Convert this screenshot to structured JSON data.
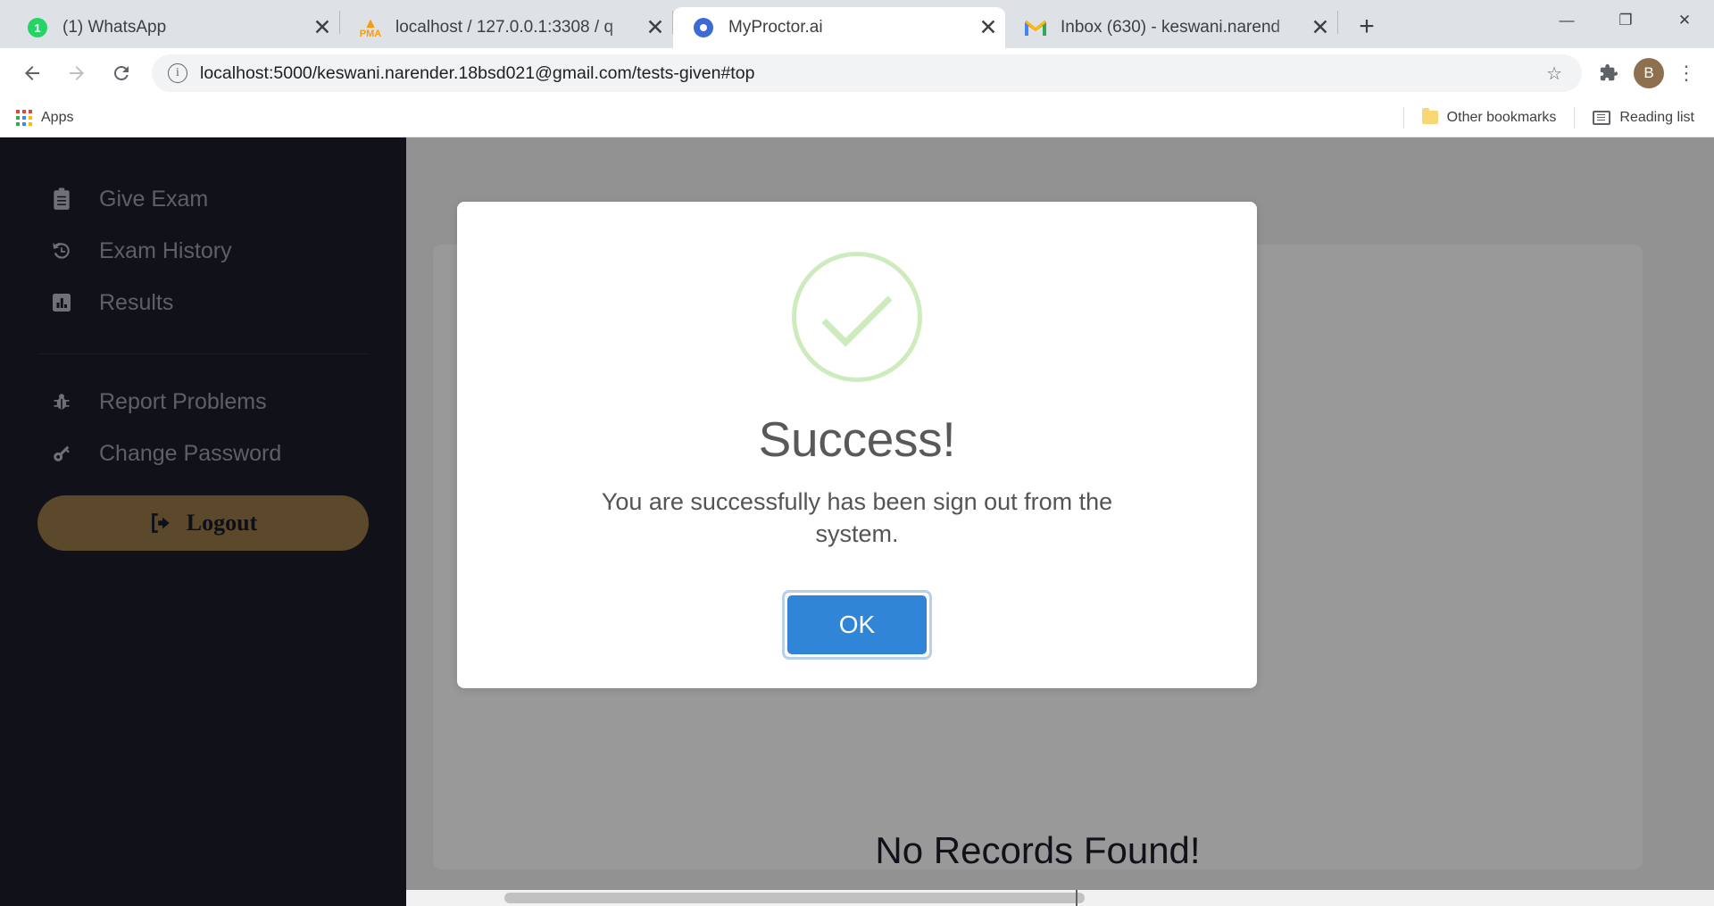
{
  "browser": {
    "tabs": [
      {
        "title": "(1) WhatsApp",
        "favicon": "whatsapp-icon",
        "badge": "1",
        "active": false
      },
      {
        "title": "localhost / 127.0.0.1:3308 / q",
        "favicon": "phpmyadmin-icon",
        "active": false
      },
      {
        "title": "MyProctor.ai",
        "favicon": "myproctor-icon",
        "active": true
      },
      {
        "title": "Inbox (630) - keswani.narend",
        "favicon": "gmail-icon",
        "active": false
      }
    ],
    "new_tab_label": "+",
    "close_label": "✕",
    "window_controls": {
      "minimize": "—",
      "maximize": "❐",
      "close": "✕"
    },
    "toolbar": {
      "back": "←",
      "forward": "→",
      "reload": "↻",
      "info_icon": "i",
      "url": "localhost:5000/keswani.narender.18bsd021@gmail.com/tests-given#top",
      "star": "☆",
      "extensions": "🧩",
      "profile_initial": "B",
      "menu": "⋮"
    },
    "bookmarks": {
      "apps_label": "Apps",
      "other_bookmarks_label": "Other bookmarks",
      "reading_list_label": "Reading list"
    }
  },
  "sidebar": {
    "items": [
      {
        "label": "Give Exam",
        "icon": "clipboard-icon",
        "glyph": "📋"
      },
      {
        "label": "Exam History",
        "icon": "history-icon",
        "glyph": "↺"
      },
      {
        "label": "Results",
        "icon": "chart-bar-icon",
        "glyph": "📊"
      }
    ],
    "items_secondary": [
      {
        "label": "Report Problems",
        "icon": "bug-icon",
        "glyph": "🐞"
      },
      {
        "label": "Change Password",
        "icon": "key-icon",
        "glyph": "🔑"
      }
    ],
    "logout": {
      "label": "Logout",
      "icon": "sign-out-icon",
      "glyph": "⇥",
      "color": "#9a7847"
    }
  },
  "main": {
    "no_records_text": "No Records Found!"
  },
  "modal": {
    "icon": "success-check-icon",
    "title": "Success!",
    "message": "You are successfully has been sign out from the system.",
    "ok_label": "OK",
    "accent_color": "#3085d6",
    "check_color": "#a5dc86"
  }
}
